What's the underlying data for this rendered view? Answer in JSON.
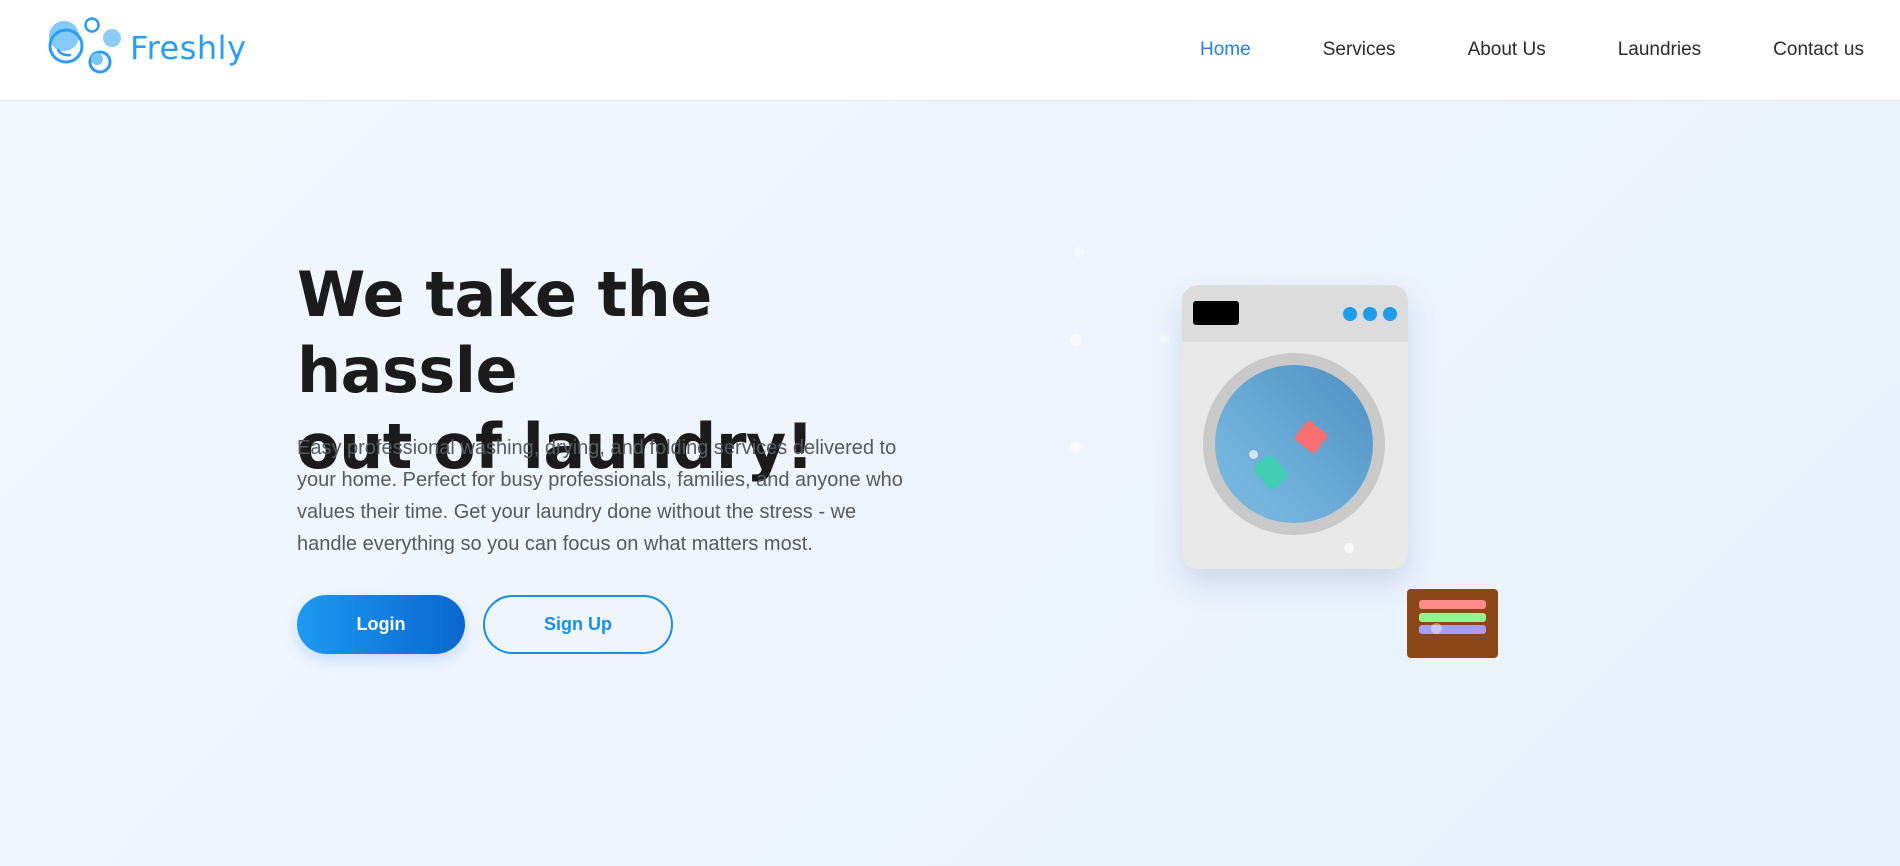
{
  "brand": {
    "name": "Freshly",
    "color": "#2a9df4",
    "icon": "bubbles-icon"
  },
  "nav": {
    "items": [
      {
        "label": "Home",
        "active": true
      },
      {
        "label": "Services",
        "active": false
      },
      {
        "label": "About Us",
        "active": false
      },
      {
        "label": "Laundries",
        "active": false
      },
      {
        "label": "Contact us",
        "active": false
      }
    ],
    "active_color": "#2b7de9"
  },
  "hero": {
    "title_line1": "We take the hassle",
    "title_line2": "out of laundry!",
    "description": "Easy professional washing, drying, and folding services delivered to your home. Perfect for busy professionals, families, and anyone who values their time. Get your laundry done without the stress - we handle everything so you can focus on what matters most.",
    "login_label": "Login",
    "signup_label": "Sign Up"
  },
  "illustration": {
    "icon": "washing-machine-icon",
    "basket_icon": "laundry-basket-icon",
    "colors": {
      "washer_body": "#e8e8e8",
      "control_dots": "#1e9be9",
      "cloth_red": "#f86f72",
      "cloth_green": "#3fcdb3",
      "basket": "#8c4718",
      "stripe_1": "#ff8a8a",
      "stripe_2": "#98f28f",
      "stripe_3": "#a99cf5"
    }
  }
}
